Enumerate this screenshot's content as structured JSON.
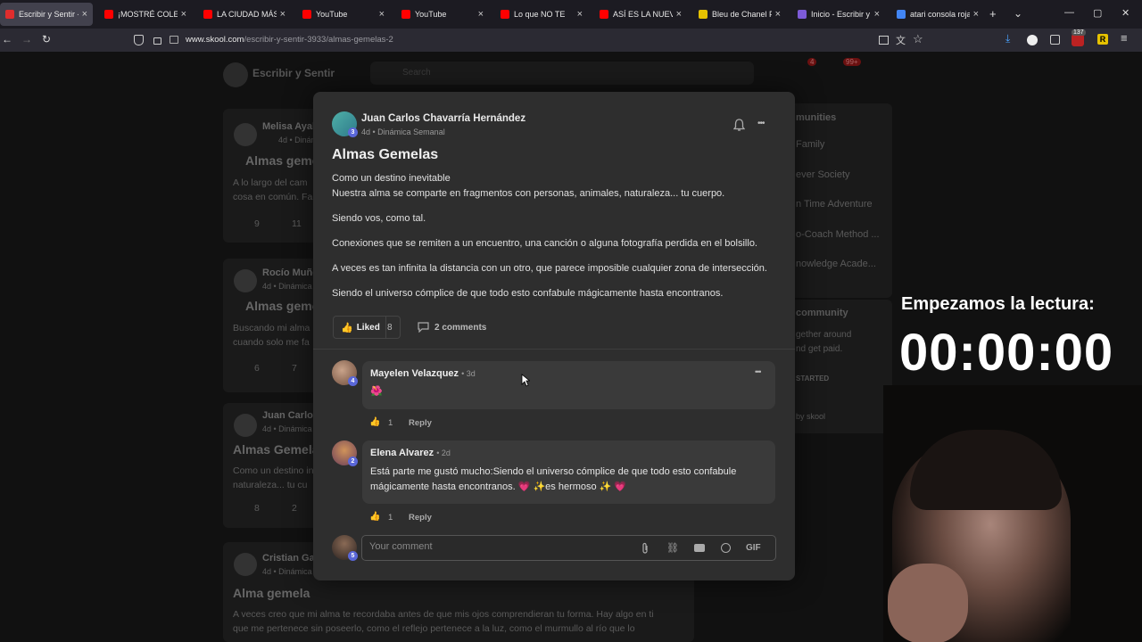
{
  "browser": {
    "tabs": [
      {
        "label": "Escribir y Sentir - Di",
        "color": "#e02d2d",
        "active": true
      },
      {
        "label": "¡MOSTRÉ COLECCI",
        "color": "#ff0000"
      },
      {
        "label": "LA CIUDAD MÁS F",
        "color": "#ff0000"
      },
      {
        "label": "YouTube",
        "color": "#ff0000"
      },
      {
        "label": "YouTube",
        "color": "#ff0000"
      },
      {
        "label": "Lo que NO TE",
        "color": "#ff0000"
      },
      {
        "label": "ASÍ ES LA NUEV",
        "color": "#ff0000"
      },
      {
        "label": "Bleu de Chanel Parf",
        "color": "#e6c200"
      },
      {
        "label": "Inicio - Escribir y Se",
        "color": "#7d5bd8"
      },
      {
        "label": "atari consola roja y",
        "color": "#4285f4"
      }
    ],
    "new_tab": "+",
    "tab_list": "⌄",
    "url_host": "www.skool.com",
    "url_path": "/escribir-y-sentir-3933/almas-gemelas-2",
    "notif_badge": "137",
    "window_min": "—",
    "window_max": "▢",
    "window_close": "✕"
  },
  "background": {
    "group_name": "Escribir y Sentir",
    "search_placeholder": "Search",
    "chat_badge": "4",
    "notif_badge": "99+",
    "cards": [
      {
        "author": "Melisa Ayal",
        "meta": "4d • Dinámica",
        "title": "Almas geme",
        "text1": "A lo largo del cam",
        "text2": "cosa en común. Fa",
        "likes": "9",
        "comments": "11"
      },
      {
        "author": "Rocío Muño",
        "meta": "4d • Dinámica",
        "title": "Almas geme",
        "text1": "Buscando mi alma",
        "text2": "cuando solo me fa",
        "likes": "6",
        "comments": "7"
      },
      {
        "author": "Juan Carlo",
        "meta": "4d • Dinámica",
        "title": "Almas Gemela",
        "text1": "Como un destino in",
        "text2": "naturaleza... tu cu",
        "likes": "8",
        "comments": "2"
      },
      {
        "author": "Cristian Gar",
        "meta": "4d • Dinámica",
        "title": "Alma gemela",
        "text1": "A veces creo que mi alma te recordaba antes de que mis ojos comprendieran tu forma. Hay algo en ti",
        "text2": "que me pertenece sin poseerlo, como el reflejo pertenece a la luz, como el murmullo al río que lo"
      }
    ],
    "right_panel": {
      "title": "munities",
      "items": [
        "Family",
        "ever Society",
        "n Time Adventure",
        "o-Coach Method ...",
        "nowledge Acade..."
      ],
      "community_title": "community",
      "community_text1": "gether around",
      "community_text2": "nd get paid.",
      "started": "STARTED",
      "powered": "by skool"
    }
  },
  "post": {
    "author": "Juan Carlos Chavarría Hernández",
    "author_level": "3",
    "meta": "4d • Dinámica Semanal",
    "title": "Almas Gemelas",
    "body": [
      "Como un destino inevitable",
      "Nuestra alma se comparte en fragmentos con personas, animales, naturaleza... tu cuerpo.",
      "Siendo vos, como tal.",
      "Conexiones que se remiten a un encuentro, una canción o alguna fotografía perdida en el bolsillo.",
      "A veces es tan infinita la distancia con un otro, que parece imposible cualquier zona de intersección.",
      "Siendo el universo cómplice de que todo esto confabule mágicamente hasta encontranos."
    ],
    "like_label": "Liked",
    "like_count": "8",
    "comments_label": "2 comments",
    "more": "•••"
  },
  "comments": [
    {
      "author": "Mayelen Velazquez",
      "time": "• 3d",
      "level": "4",
      "text": "🌺",
      "likes": "1",
      "reply": "Reply"
    },
    {
      "author": "Elena Alvarez",
      "time": "• 2d",
      "level": "2",
      "text1": "Está parte me gustó mucho:Siendo el universo cómplice de que todo esto confabule",
      "text2": "mágicamente hasta encontranos. 💗 ✨es hermoso ✨ 💗",
      "likes": "1",
      "reply": "Reply"
    }
  ],
  "comment_box": {
    "placeholder": "Your comment",
    "user_level": "5",
    "gif": "GIF"
  },
  "overlay": {
    "reading_label": "Empezamos la lectura:",
    "timer": "00:00:00"
  }
}
